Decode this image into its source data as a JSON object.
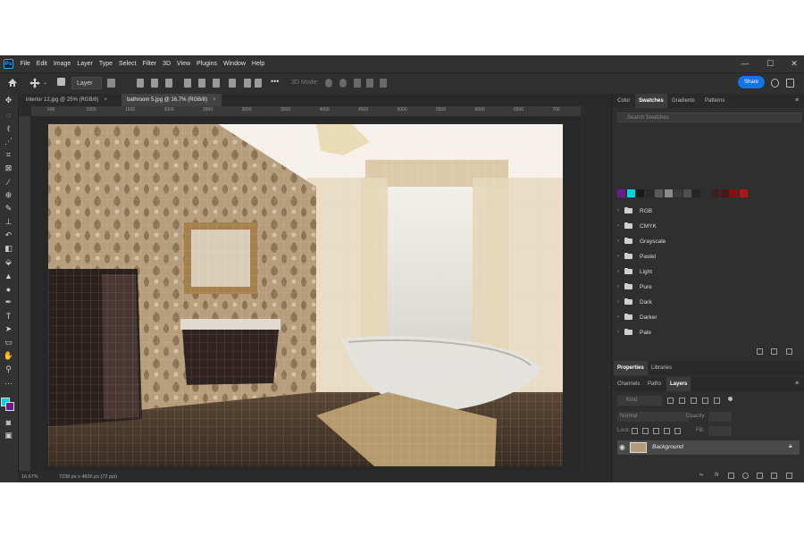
{
  "menu": {
    "logo": "Ps",
    "items": [
      "File",
      "Edit",
      "Image",
      "Layer",
      "Type",
      "Select",
      "Filter",
      "3D",
      "View",
      "Plugins",
      "Window",
      "Help"
    ]
  },
  "window_controls": {
    "minimize": "—",
    "maximize": "☐",
    "close": "✕"
  },
  "options_bar": {
    "layer_select": "Layer",
    "three_d_mode": "3D Mode:",
    "share": "Share"
  },
  "doc_tabs": [
    {
      "label": "interior 12.jpg @ 25% (RGB/8)",
      "close": "×"
    },
    {
      "label": "bathroom 5.jpg @ 16.7% (RGB/8)",
      "close": "×"
    }
  ],
  "ruler_ticks": [
    "500",
    "1000",
    "1500",
    "2000",
    "2500",
    "3000",
    "3500",
    "4000",
    "4500",
    "5000",
    "5500",
    "6000",
    "6500",
    "700"
  ],
  "status": {
    "zoom": "16.67%",
    "doc_info": "7238 px x 4826 px (72 ppi)"
  },
  "swatches_panel": {
    "tabs": [
      "Color",
      "Swatches",
      "Gradients",
      "Patterns"
    ],
    "active_tab": "Swatches",
    "search_placeholder": "Search Swatches",
    "recent_colors": [
      "#6a1b8f",
      "#00d4e0",
      "#1a1a1a",
      "#2a2a2a",
      "#5a5a5a",
      "#8a8a8a",
      "#3a3a3a",
      "#505050",
      "#252525",
      "#2e2e2e",
      "#3d1f1f",
      "#4d1515",
      "#8a0f0f",
      "#b01515"
    ],
    "groups": [
      "RGB",
      "CMYK",
      "Grayscale",
      "Pastel",
      "Light",
      "Pure",
      "Dark",
      "Darker",
      "Pale"
    ]
  },
  "properties_panel": {
    "tabs": [
      "Properties",
      "Libraries"
    ],
    "active_tab": "Properties"
  },
  "layers_panel": {
    "tabs": [
      "Channels",
      "Paths",
      "Layers"
    ],
    "active_tab": "Layers",
    "kind_filter": "Kind",
    "blend_mode": "Normal",
    "opacity_label": "Opacity:",
    "lock_label": "Lock:",
    "fill_label": "Fill:",
    "layers": [
      {
        "name": "Background",
        "visible": true,
        "locked": true
      }
    ]
  },
  "colors": {
    "foreground": "#00d4e0",
    "background": "#6a1b8f",
    "accent": "#1473e6"
  }
}
